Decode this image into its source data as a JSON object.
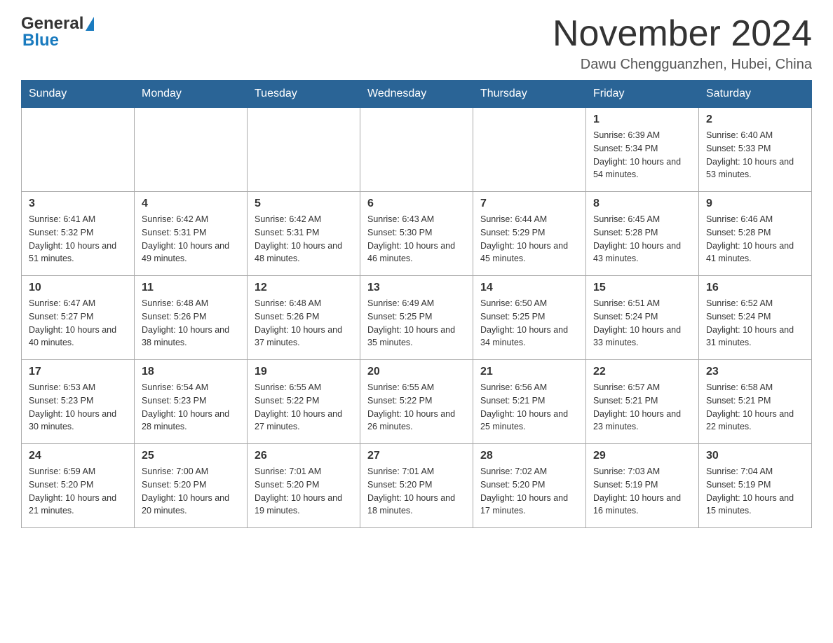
{
  "logo": {
    "text_general": "General",
    "text_blue": "Blue"
  },
  "header": {
    "month_year": "November 2024",
    "location": "Dawu Chengguanzhen, Hubei, China"
  },
  "weekdays": [
    "Sunday",
    "Monday",
    "Tuesday",
    "Wednesday",
    "Thursday",
    "Friday",
    "Saturday"
  ],
  "weeks": [
    [
      {
        "day": "",
        "info": ""
      },
      {
        "day": "",
        "info": ""
      },
      {
        "day": "",
        "info": ""
      },
      {
        "day": "",
        "info": ""
      },
      {
        "day": "",
        "info": ""
      },
      {
        "day": "1",
        "info": "Sunrise: 6:39 AM\nSunset: 5:34 PM\nDaylight: 10 hours and 54 minutes."
      },
      {
        "day": "2",
        "info": "Sunrise: 6:40 AM\nSunset: 5:33 PM\nDaylight: 10 hours and 53 minutes."
      }
    ],
    [
      {
        "day": "3",
        "info": "Sunrise: 6:41 AM\nSunset: 5:32 PM\nDaylight: 10 hours and 51 minutes."
      },
      {
        "day": "4",
        "info": "Sunrise: 6:42 AM\nSunset: 5:31 PM\nDaylight: 10 hours and 49 minutes."
      },
      {
        "day": "5",
        "info": "Sunrise: 6:42 AM\nSunset: 5:31 PM\nDaylight: 10 hours and 48 minutes."
      },
      {
        "day": "6",
        "info": "Sunrise: 6:43 AM\nSunset: 5:30 PM\nDaylight: 10 hours and 46 minutes."
      },
      {
        "day": "7",
        "info": "Sunrise: 6:44 AM\nSunset: 5:29 PM\nDaylight: 10 hours and 45 minutes."
      },
      {
        "day": "8",
        "info": "Sunrise: 6:45 AM\nSunset: 5:28 PM\nDaylight: 10 hours and 43 minutes."
      },
      {
        "day": "9",
        "info": "Sunrise: 6:46 AM\nSunset: 5:28 PM\nDaylight: 10 hours and 41 minutes."
      }
    ],
    [
      {
        "day": "10",
        "info": "Sunrise: 6:47 AM\nSunset: 5:27 PM\nDaylight: 10 hours and 40 minutes."
      },
      {
        "day": "11",
        "info": "Sunrise: 6:48 AM\nSunset: 5:26 PM\nDaylight: 10 hours and 38 minutes."
      },
      {
        "day": "12",
        "info": "Sunrise: 6:48 AM\nSunset: 5:26 PM\nDaylight: 10 hours and 37 minutes."
      },
      {
        "day": "13",
        "info": "Sunrise: 6:49 AM\nSunset: 5:25 PM\nDaylight: 10 hours and 35 minutes."
      },
      {
        "day": "14",
        "info": "Sunrise: 6:50 AM\nSunset: 5:25 PM\nDaylight: 10 hours and 34 minutes."
      },
      {
        "day": "15",
        "info": "Sunrise: 6:51 AM\nSunset: 5:24 PM\nDaylight: 10 hours and 33 minutes."
      },
      {
        "day": "16",
        "info": "Sunrise: 6:52 AM\nSunset: 5:24 PM\nDaylight: 10 hours and 31 minutes."
      }
    ],
    [
      {
        "day": "17",
        "info": "Sunrise: 6:53 AM\nSunset: 5:23 PM\nDaylight: 10 hours and 30 minutes."
      },
      {
        "day": "18",
        "info": "Sunrise: 6:54 AM\nSunset: 5:23 PM\nDaylight: 10 hours and 28 minutes."
      },
      {
        "day": "19",
        "info": "Sunrise: 6:55 AM\nSunset: 5:22 PM\nDaylight: 10 hours and 27 minutes."
      },
      {
        "day": "20",
        "info": "Sunrise: 6:55 AM\nSunset: 5:22 PM\nDaylight: 10 hours and 26 minutes."
      },
      {
        "day": "21",
        "info": "Sunrise: 6:56 AM\nSunset: 5:21 PM\nDaylight: 10 hours and 25 minutes."
      },
      {
        "day": "22",
        "info": "Sunrise: 6:57 AM\nSunset: 5:21 PM\nDaylight: 10 hours and 23 minutes."
      },
      {
        "day": "23",
        "info": "Sunrise: 6:58 AM\nSunset: 5:21 PM\nDaylight: 10 hours and 22 minutes."
      }
    ],
    [
      {
        "day": "24",
        "info": "Sunrise: 6:59 AM\nSunset: 5:20 PM\nDaylight: 10 hours and 21 minutes."
      },
      {
        "day": "25",
        "info": "Sunrise: 7:00 AM\nSunset: 5:20 PM\nDaylight: 10 hours and 20 minutes."
      },
      {
        "day": "26",
        "info": "Sunrise: 7:01 AM\nSunset: 5:20 PM\nDaylight: 10 hours and 19 minutes."
      },
      {
        "day": "27",
        "info": "Sunrise: 7:01 AM\nSunset: 5:20 PM\nDaylight: 10 hours and 18 minutes."
      },
      {
        "day": "28",
        "info": "Sunrise: 7:02 AM\nSunset: 5:20 PM\nDaylight: 10 hours and 17 minutes."
      },
      {
        "day": "29",
        "info": "Sunrise: 7:03 AM\nSunset: 5:19 PM\nDaylight: 10 hours and 16 minutes."
      },
      {
        "day": "30",
        "info": "Sunrise: 7:04 AM\nSunset: 5:19 PM\nDaylight: 10 hours and 15 minutes."
      }
    ]
  ]
}
